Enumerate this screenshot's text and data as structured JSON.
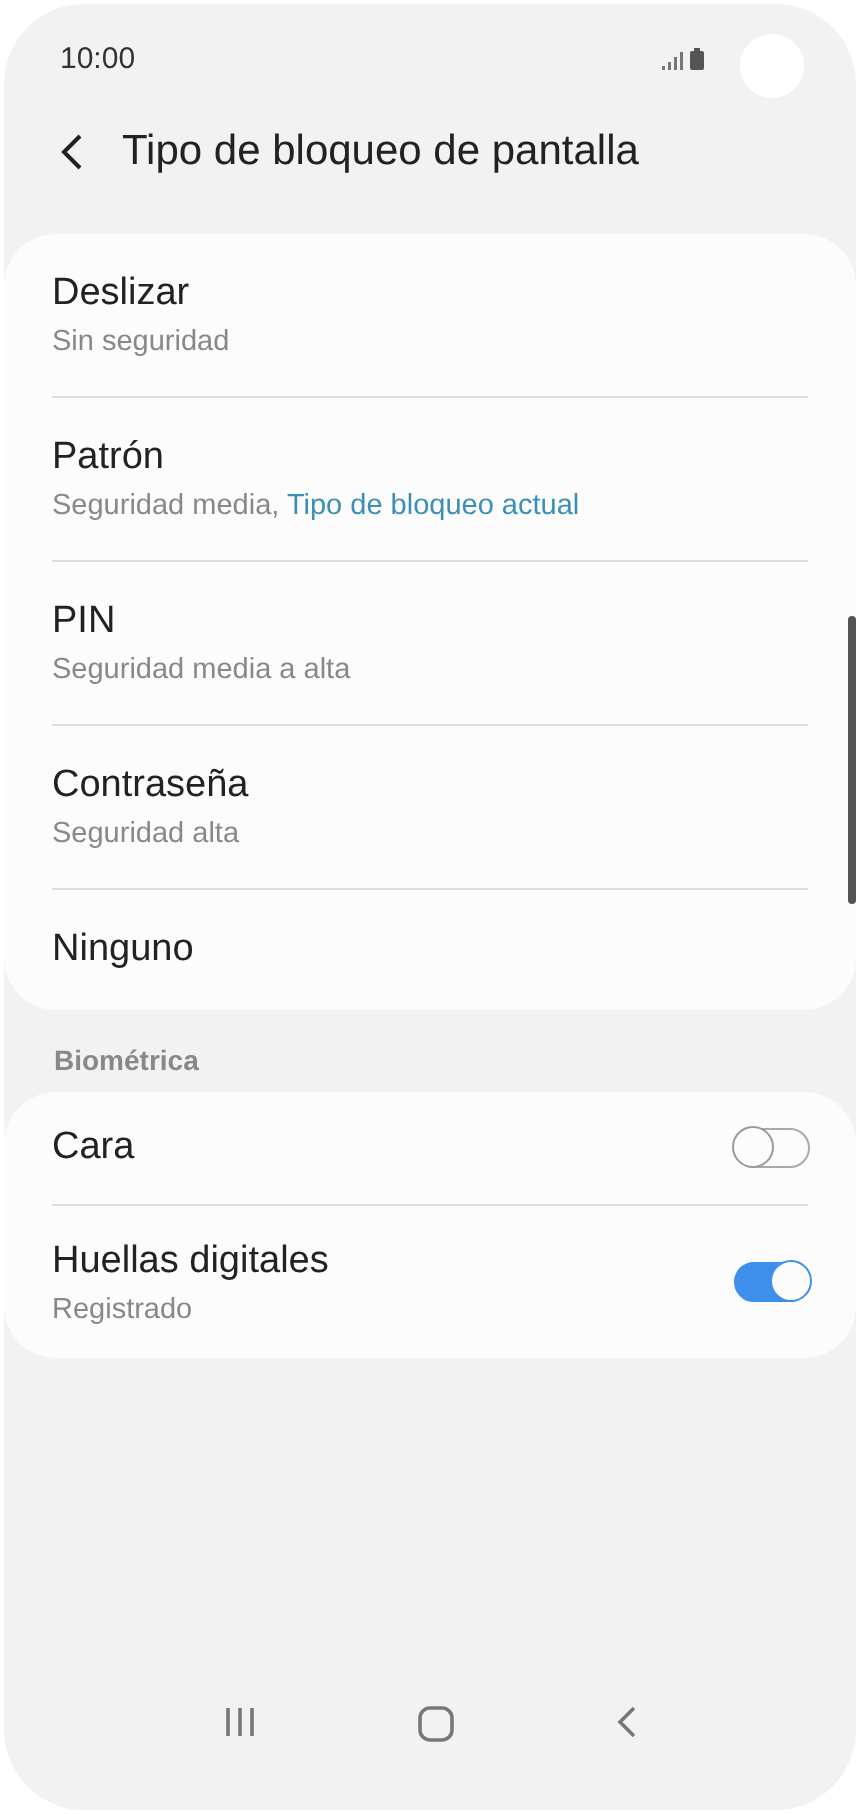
{
  "status_bar": {
    "time": "10:00"
  },
  "header": {
    "title": "Tipo de bloqueo de pantalla"
  },
  "lock_types": [
    {
      "title": "Deslizar",
      "subtitle": "Sin seguridad"
    },
    {
      "title": "Patrón",
      "subtitle": "Seguridad media, ",
      "note": "Tipo de bloqueo actual"
    },
    {
      "title": "PIN",
      "subtitle": "Seguridad media a alta"
    },
    {
      "title": "Contraseña",
      "subtitle": "Seguridad alta"
    },
    {
      "title": "Ninguno"
    }
  ],
  "biometrics": {
    "heading": "Biométrica",
    "items": [
      {
        "title": "Cara",
        "on": false
      },
      {
        "title": "Huellas digitales",
        "subtitle": "Registrado",
        "on": true
      }
    ]
  }
}
